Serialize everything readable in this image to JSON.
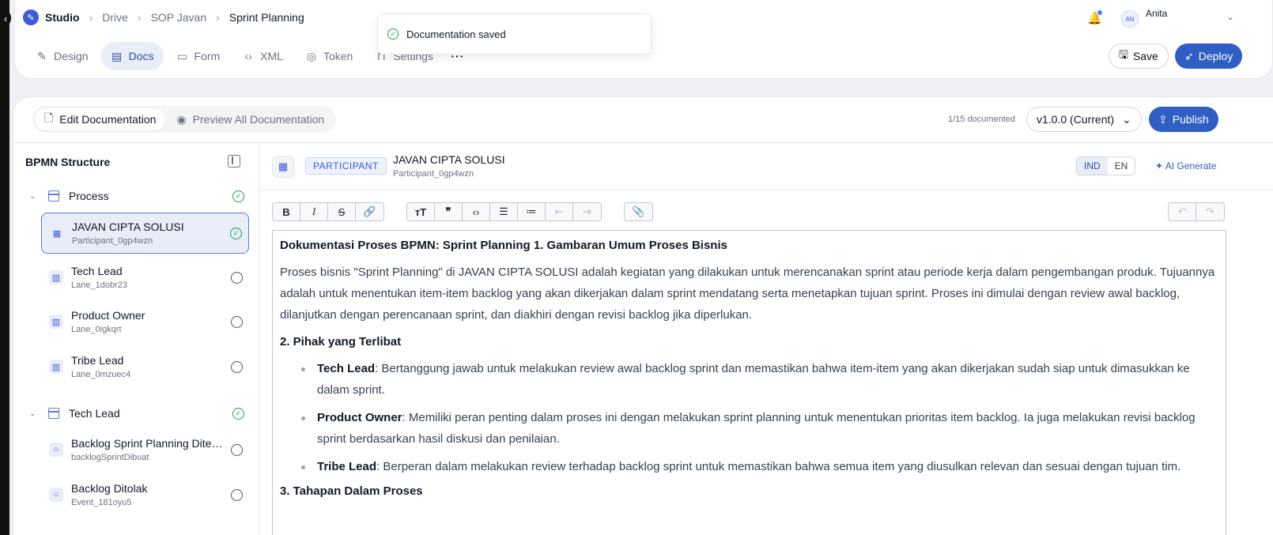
{
  "topbar": {
    "brand": "Studio",
    "breadcrumbs": [
      "Drive",
      "SOP Javan",
      "Sprint Planning"
    ],
    "user_initials": "AN",
    "user_name": "Anita"
  },
  "toast": {
    "message": "Documentation saved"
  },
  "tabs": [
    {
      "label": "Design",
      "icon": "pen-icon",
      "active": false
    },
    {
      "label": "Docs",
      "icon": "document-icon",
      "active": true
    },
    {
      "label": "Form",
      "icon": "form-icon",
      "active": false
    },
    {
      "label": "XML",
      "icon": "code-icon",
      "active": false
    },
    {
      "label": "Token",
      "icon": "token-icon",
      "active": false
    },
    {
      "label": "Settings",
      "icon": "paint-roller-icon",
      "active": false
    }
  ],
  "actions": {
    "save_label": "Save",
    "deploy_label": "Deploy"
  },
  "doc_toolbar": {
    "edit_label": "Edit Documentation",
    "preview_label": "Preview All Documentation",
    "doc_count": "1/15 documented",
    "version": "v1.0.0 (Current)",
    "publish_label": "Publish"
  },
  "sidebar": {
    "title": "BPMN Structure",
    "groups": [
      {
        "label": "Process",
        "done": true,
        "items": [
          {
            "name": "JAVAN CIPTA SOLUSI",
            "id": "Participant_0gp4wzn",
            "done": true,
            "selected": true,
            "icon": "building-icon"
          },
          {
            "name": "Tech Lead",
            "id": "Lane_1dobr23",
            "done": false,
            "icon": "lane-icon"
          },
          {
            "name": "Product Owner",
            "id": "Lane_0igkqrt",
            "done": false,
            "icon": "lane-icon"
          },
          {
            "name": "Tribe Lead",
            "id": "Lane_0mzuec4",
            "done": false,
            "icon": "lane-icon"
          }
        ]
      },
      {
        "label": "Tech Lead",
        "done": true,
        "items": [
          {
            "name": "Backlog Sprint Planning Diterima",
            "id": "backlogSprintDibuat",
            "done": false,
            "icon": "event-circle-icon"
          },
          {
            "name": "Backlog Ditolak",
            "id": "Event_181oyu5",
            "done": false,
            "icon": "event-circle-icon"
          }
        ]
      }
    ]
  },
  "element": {
    "type_badge": "PARTICIPANT",
    "name": "JAVAN CIPTA SOLUSI",
    "id": "Participant_0gp4wzn",
    "languages": [
      "IND",
      "EN"
    ],
    "active_language": "IND",
    "ai_label": "AI Generate"
  },
  "editor": {
    "heading1": "Dokumentasi Proses BPMN: Sprint Planning 1. Gambaran Umum Proses Bisnis",
    "para1": "Proses bisnis \"Sprint Planning\" di JAVAN CIPTA SOLUSI adalah kegiatan yang dilakukan untuk merencanakan sprint atau periode kerja dalam pengembangan produk. Tujuannya adalah untuk menentukan item-item backlog yang akan dikerjakan dalam sprint mendatang serta menetapkan tujuan sprint. Proses ini dimulai dengan review awal backlog, dilanjutkan dengan perencanaan sprint, dan diakhiri dengan revisi backlog jika diperlukan.",
    "heading2": "2. Pihak yang Terlibat",
    "roles": [
      {
        "role": "Tech Lead",
        "desc": ": Bertanggung jawab untuk melakukan review awal backlog sprint dan memastikan bahwa item-item yang akan dikerjakan sudah siap untuk dimasukkan ke dalam sprint."
      },
      {
        "role": "Product Owner",
        "desc": ": Memiliki peran penting dalam proses ini dengan melakukan sprint planning untuk menentukan prioritas item backlog. Ia juga melakukan revisi backlog sprint berdasarkan hasil diskusi dan penilaian."
      },
      {
        "role": "Tribe Lead",
        "desc": ": Berperan dalam melakukan review terhadap backlog sprint untuk memastikan bahwa semua item yang diusulkan relevan dan sesuai dengan tujuan tim."
      }
    ],
    "heading3": "3. Tahapan Dalam Proses"
  },
  "colors": {
    "accent": "#2f5fc4",
    "success": "#16a34a",
    "selected_bg": "#e8edf7"
  }
}
